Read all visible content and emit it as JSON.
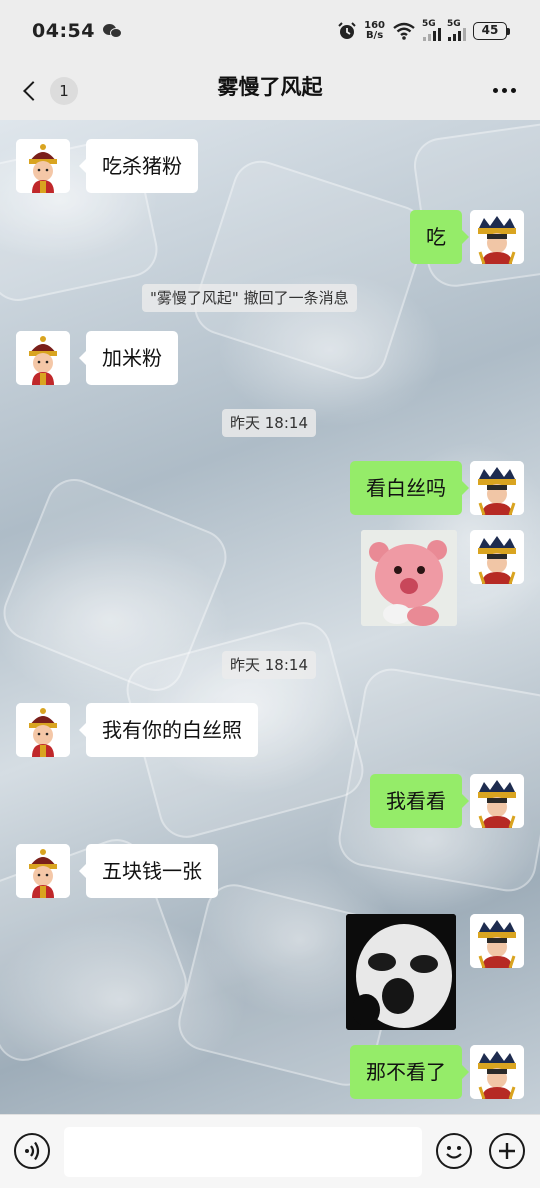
{
  "status_bar": {
    "time": "04:54",
    "net_speed_value": "160",
    "net_speed_unit": "B/s",
    "sim1_label": "5G",
    "sim2_label": "5G",
    "battery": "45"
  },
  "header": {
    "back_badge": "1",
    "title": "雾慢了风起"
  },
  "messages": [
    {
      "sender": "other",
      "type": "text",
      "text": "吃杀猪粉"
    },
    {
      "sender": "me",
      "type": "text",
      "text": "吃"
    },
    {
      "type": "system",
      "text": "\"雾慢了风起\" 撤回了一条消息"
    },
    {
      "sender": "other",
      "type": "text",
      "text": "加米粉"
    },
    {
      "type": "time",
      "text": "昨天 18:14"
    },
    {
      "sender": "me",
      "type": "text",
      "text": "看白丝吗"
    },
    {
      "sender": "me",
      "type": "sticker",
      "sticker": "pink-bear-sticker"
    },
    {
      "type": "time",
      "text": "昨天 18:14"
    },
    {
      "sender": "other",
      "type": "text",
      "text": "我有你的白丝照"
    },
    {
      "sender": "me",
      "type": "text",
      "text": "我看看"
    },
    {
      "sender": "other",
      "type": "text",
      "text": "五块钱一张"
    },
    {
      "sender": "me",
      "type": "sticker",
      "sticker": "blurry-face-sticker"
    },
    {
      "sender": "me",
      "type": "text",
      "text": "那不看了"
    }
  ],
  "input_bar": {
    "input_value": "",
    "icons": [
      "voice-icon",
      "emoji-icon",
      "plus-icon"
    ]
  },
  "colors": {
    "outgoing_bubble": "#95ec69",
    "incoming_bubble": "#ffffff",
    "bar_background": "#ededed"
  }
}
